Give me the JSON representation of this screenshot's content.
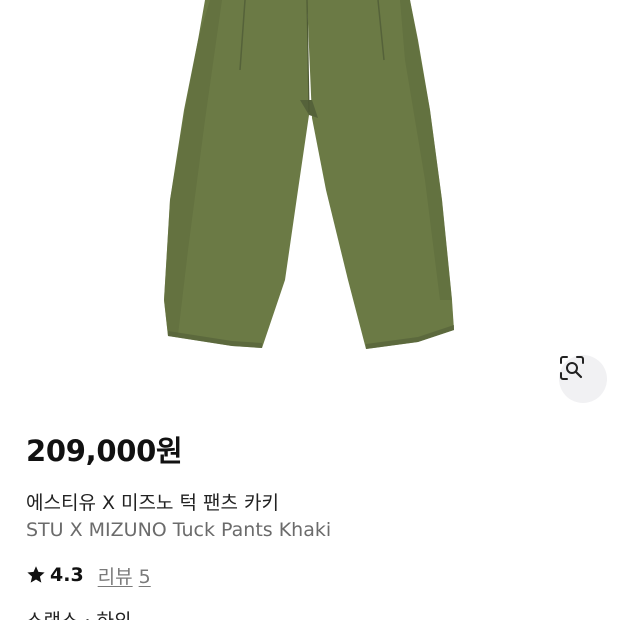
{
  "product": {
    "price": "209,000원",
    "title_ko": "에스티유 X 미즈노 턱 팬츠 카키",
    "title_en": "STU X MIZUNO Tuck Pants Khaki",
    "rating": "4.3",
    "review_label": "리뷰",
    "review_count": "5",
    "partial_line": "스랙스 · 하의",
    "image_icon": "khaki-pants-photo",
    "visual_search_icon": "camera-scan-icon"
  },
  "colors": {
    "pants": "#6b7a45",
    "pants_shadow": "#55623a",
    "icon_button_bg": "#f1f1f3"
  }
}
